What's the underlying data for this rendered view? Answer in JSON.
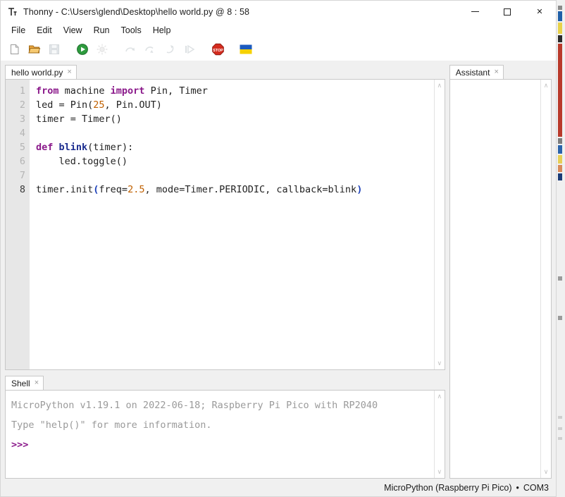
{
  "window": {
    "title": "Thonny  -  C:\\Users\\glend\\Desktop\\hello world.py  @  8 : 58",
    "icon": "thonny-logo-icon",
    "controls": {
      "minimize": "minimize-icon",
      "maximize": "maximize-icon",
      "close": "✕"
    }
  },
  "menubar": {
    "items": [
      {
        "label": "File"
      },
      {
        "label": "Edit"
      },
      {
        "label": "View"
      },
      {
        "label": "Run"
      },
      {
        "label": "Tools"
      },
      {
        "label": "Help"
      }
    ]
  },
  "toolbar": {
    "buttons": [
      {
        "name": "new-file-icon",
        "tooltip": "New",
        "enabled": true
      },
      {
        "name": "open-file-icon",
        "tooltip": "Load",
        "enabled": true
      },
      {
        "name": "save-file-icon",
        "tooltip": "Save",
        "enabled": false
      },
      {
        "name": "run-icon",
        "tooltip": "Run current script",
        "enabled": true
      },
      {
        "name": "debug-icon",
        "tooltip": "Debug current script",
        "enabled": false
      },
      {
        "name": "step-over-icon",
        "tooltip": "Step over",
        "enabled": false
      },
      {
        "name": "step-into-icon",
        "tooltip": "Step into",
        "enabled": false
      },
      {
        "name": "step-out-icon",
        "tooltip": "Step out",
        "enabled": false
      },
      {
        "name": "resume-icon",
        "tooltip": "Resume",
        "enabled": false
      },
      {
        "name": "stop-icon",
        "tooltip": "Stop/Restart backend",
        "enabled": true
      },
      {
        "name": "ukraine-flag-icon",
        "tooltip": "Support Ukraine",
        "enabled": true
      }
    ]
  },
  "editor": {
    "tab": {
      "label": "hello world.py",
      "close": "×"
    },
    "line_numbers": [
      "1",
      "2",
      "3",
      "4",
      "5",
      "6",
      "7",
      "8"
    ],
    "current_line": 8,
    "lines": [
      [
        {
          "t": "from",
          "c": "kw"
        },
        {
          "t": " machine ",
          "c": ""
        },
        {
          "t": "import",
          "c": "kw"
        },
        {
          "t": " Pin, Timer",
          "c": ""
        }
      ],
      [
        {
          "t": "led = Pin(",
          "c": ""
        },
        {
          "t": "25",
          "c": "num"
        },
        {
          "t": ", Pin.OUT)",
          "c": ""
        }
      ],
      [
        {
          "t": "timer = Timer()",
          "c": ""
        }
      ],
      [
        {
          "t": "",
          "c": ""
        }
      ],
      [
        {
          "t": "def",
          "c": "kw"
        },
        {
          "t": " ",
          "c": ""
        },
        {
          "t": "blink",
          "c": "fn"
        },
        {
          "t": "(timer):",
          "c": ""
        }
      ],
      [
        {
          "t": "    led.toggle()",
          "c": ""
        }
      ],
      [
        {
          "t": "",
          "c": ""
        }
      ],
      [
        {
          "t": "timer.init",
          "c": ""
        },
        {
          "t": "(",
          "c": "par"
        },
        {
          "t": "freq=",
          "c": ""
        },
        {
          "t": "2.5",
          "c": "num"
        },
        {
          "t": ", mode=Timer.PERIODIC, callback=blink",
          "c": ""
        },
        {
          "t": ")",
          "c": "par"
        }
      ]
    ]
  },
  "shell": {
    "tab": {
      "label": "Shell",
      "close": "×"
    },
    "lines": [
      {
        "text": "MicroPython v1.19.1 on 2022-06-18; Raspberry Pi Pico with RP2040",
        "style": "output"
      },
      {
        "text": "Type \"help()\" for more information.",
        "style": "output"
      },
      {
        "text": ">>>",
        "style": "prompt"
      }
    ]
  },
  "assistant": {
    "tab": {
      "label": "Assistant",
      "close": "×"
    },
    "content": ""
  },
  "statusbar": {
    "interpreter": "MicroPython (Raspberry Pi Pico)",
    "separator": "•",
    "port": "COM3"
  },
  "scrollbars": {
    "up_arrow": "∧",
    "down_arrow": "∨"
  },
  "colors": {
    "keyword": "#8b1a8b",
    "function": "#1c2d8f",
    "number": "#c06000",
    "paren": "#1a3fb8",
    "shell_text": "#9a9a9a",
    "gutter_bg": "#e7e7e7",
    "run_green": "#2e9b3e",
    "stop_red": "#d42b1e",
    "ukraine_blue": "#1c5bbf",
    "ukraine_yellow": "#f5d100"
  }
}
